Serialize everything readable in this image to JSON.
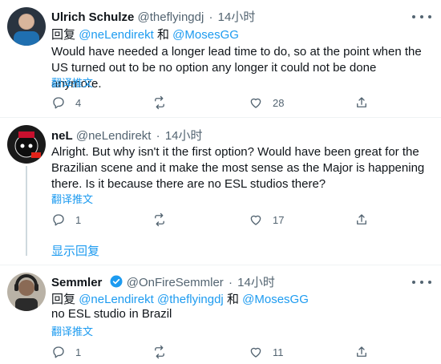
{
  "tweets": [
    {
      "name": "Ulrich Schulze",
      "handle": "@theflyingdj",
      "sep": "·",
      "time": "14小时",
      "reply_prefix": "回复",
      "mention1": "@neLendirekt",
      "and": "和",
      "mention2": "@MosesGG",
      "text": "Would have needed a longer lead time to do, so at the point when the US turned out to be no option any longer it could not be done anymore.",
      "translate": "翻译推文",
      "replies": "4",
      "retweets": "",
      "likes": "28"
    },
    {
      "name": "neL",
      "handle": "@neLendirekt",
      "sep": "·",
      "time": "14小时",
      "text": "Alright. But why isn't it the first option? Would have been great for the Brazilian scene and it make the most sense as the Major is happening there. Is it because there are no ESL studios there?",
      "translate": "翻译推文",
      "replies": "1",
      "retweets": "",
      "likes": "17"
    },
    {
      "name": "Semmler",
      "handle": "@OnFireSemmler",
      "sep": "·",
      "time": "14小时",
      "reply_prefix": "回复",
      "mention1": "@neLendirekt",
      "mention_between": "@theflyingdj",
      "and": "和",
      "mention2": "@MosesGG",
      "text": "no ESL studio in Brazil",
      "translate": "翻译推文",
      "replies": "1",
      "retweets": "",
      "likes": "11"
    }
  ],
  "show_replies": "显示回复",
  "colors": {
    "accent": "#1d9bf0",
    "secondary_text": "#536471",
    "verified": "#1d9bf0"
  },
  "icons": [
    "reply-icon",
    "retweet-icon",
    "like-icon",
    "share-icon",
    "more-icon",
    "verified-icon"
  ]
}
